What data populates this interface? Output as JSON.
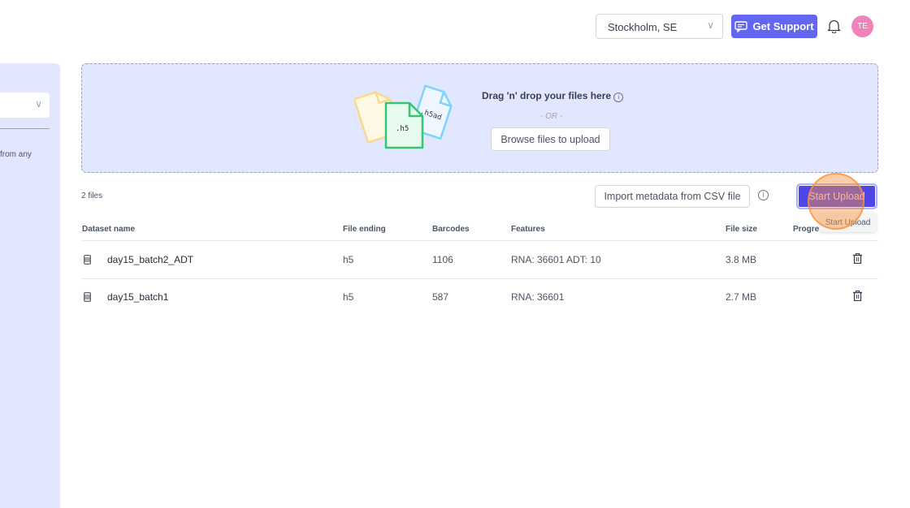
{
  "header": {
    "location": "Stockholm, SE",
    "support_label": "Get Support",
    "avatar_initials": "TE",
    "accent": "#6366f1"
  },
  "left_panel": {
    "text": "from any"
  },
  "dropzone": {
    "title": "Drag 'n' drop your files here",
    "or": "- OR -",
    "browse_label": "Browse files to upload",
    "illustration_labels": [
      ".h5",
      ".h5ad"
    ]
  },
  "toolbar": {
    "count": "2 files",
    "import_label": "Import metadata from CSV file",
    "start_label": "Start Upload",
    "tooltip": "Start Upload"
  },
  "table": {
    "columns": [
      "Dataset name",
      "File ending",
      "Barcodes",
      "Features",
      "File size",
      "Progre"
    ],
    "rows": [
      {
        "name": "day15_batch2_ADT",
        "ending": "h5",
        "barcodes": "1106",
        "features": "RNA: 36601 ADT: 10",
        "size": "3.8 MB"
      },
      {
        "name": "day15_batch1",
        "ending": "h5",
        "barcodes": "587",
        "features": "RNA: 36601",
        "size": "2.7 MB"
      }
    ]
  }
}
